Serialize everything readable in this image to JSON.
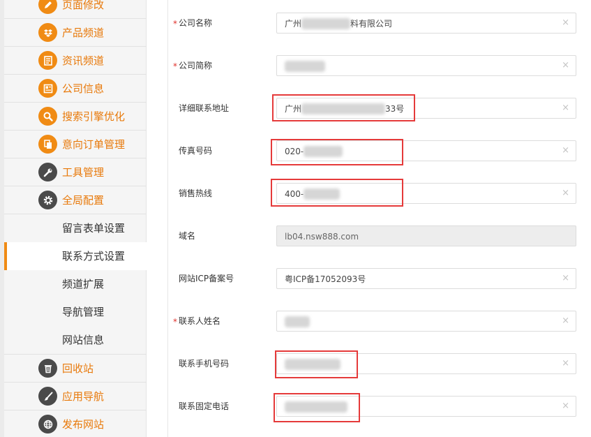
{
  "sidebar": {
    "items": [
      {
        "label": "页面修改",
        "icon": "pencil-icon"
      },
      {
        "label": "产品频道",
        "icon": "dropbox-icon"
      },
      {
        "label": "资讯频道",
        "icon": "news-icon"
      },
      {
        "label": "公司信息",
        "icon": "newspaper-icon"
      },
      {
        "label": "搜索引擎优化",
        "icon": "search-icon"
      },
      {
        "label": "意向订单管理",
        "icon": "copy-icon"
      },
      {
        "label": "工具管理",
        "icon": "wrench-icon"
      },
      {
        "label": "全局配置",
        "icon": "gear-icon"
      }
    ],
    "subitems": [
      {
        "label": "留言表单设置"
      },
      {
        "label": "联系方式设置"
      },
      {
        "label": "频道扩展"
      },
      {
        "label": "导航管理"
      },
      {
        "label": "网站信息"
      }
    ],
    "items_bottom": [
      {
        "label": "回收站",
        "icon": "trash-icon"
      },
      {
        "label": "应用导航",
        "icon": "brush-icon"
      },
      {
        "label": "发布网站",
        "icon": "globe-icon"
      }
    ]
  },
  "form": {
    "required_mark": "*",
    "clear_glyph": "×",
    "fields": [
      {
        "label": "公司名称",
        "value_prefix": "广州",
        "value_suffix": "料有限公司"
      },
      {
        "label": "公司简称"
      },
      {
        "label": "详细联系地址",
        "value_prefix": "广州",
        "value_suffix": "33号"
      },
      {
        "label": "传真号码",
        "value_prefix": "020-"
      },
      {
        "label": "销售热线",
        "value_prefix": "400-"
      },
      {
        "label": "域名",
        "value": "lb04.nsw888.com"
      },
      {
        "label": "网站ICP备案号",
        "value": "粤ICP备17052093号"
      },
      {
        "label": "联系人姓名"
      },
      {
        "label": "联系手机号码"
      },
      {
        "label": "联系固定电话"
      }
    ]
  },
  "colors": {
    "accent": "#f08b14",
    "highlight_box": "#e53a3a",
    "required": "#e0312b"
  }
}
